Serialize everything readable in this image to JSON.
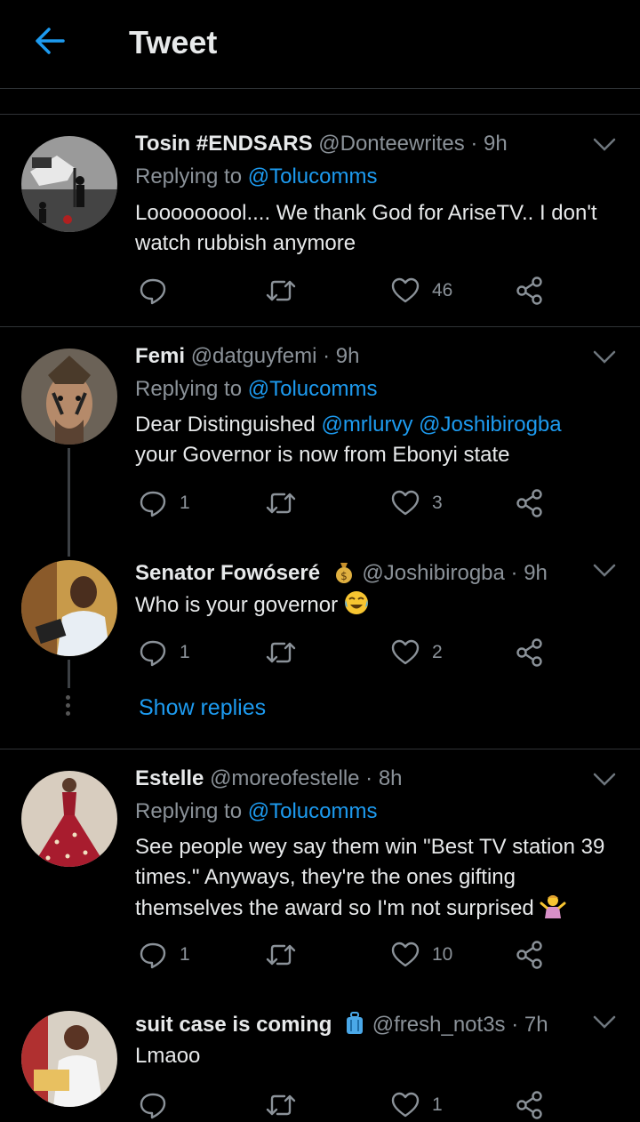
{
  "header": {
    "title": "Tweet",
    "back_icon": "arrow-left-icon",
    "accent": "#1d9bf0"
  },
  "tweets": [
    {
      "name": "Tosin #ENDSARS",
      "meta": "@Donteewrites · 9h",
      "replying_prefix": "Replying to",
      "replying_handle": "@Tolucomms",
      "text": "Looooooool.... We thank God for AriseTV.. I don't watch rubbish anymore",
      "replies": "",
      "retweets": "",
      "likes": "46"
    },
    {
      "name": "Femi",
      "meta": "@datguyfemi · 9h",
      "replying_prefix": "Replying to",
      "replying_handle": "@Tolucomms",
      "text_prefix": "Dear Distinguished",
      "mention_1": "@mrlurvy",
      "mention_2": "@Joshibirogba",
      "text_suffix": "your Governor is now from Ebonyi state",
      "replies": "1",
      "retweets": "",
      "likes": "3"
    },
    {
      "name": "Senator Fowóseré",
      "name_emoji": "money-bag-emoji",
      "meta": "@Joshibirogba · 9h",
      "text": "Who is your governor",
      "text_emoji": "tears-of-joy-emoji",
      "replies": "1",
      "retweets": "",
      "likes": "2"
    },
    {
      "name": "Estelle",
      "meta": "@moreofestelle · 8h",
      "replying_prefix": "Replying to",
      "replying_handle": "@Tolucomms",
      "text": "See people wey say them win \"Best TV station 39 times.\" Anyways, they're the ones gifting themselves the award so I'm not surprised",
      "text_emoji": "person-shrugging-emoji",
      "replies": "1",
      "retweets": "",
      "likes": "10"
    },
    {
      "name": "suit case is coming",
      "name_emoji": "luggage-emoji",
      "meta": "@fresh_not3s · 7h",
      "text": "Lmaoo",
      "replies": "",
      "retweets": "",
      "likes": "1"
    }
  ],
  "show_replies": "Show replies"
}
